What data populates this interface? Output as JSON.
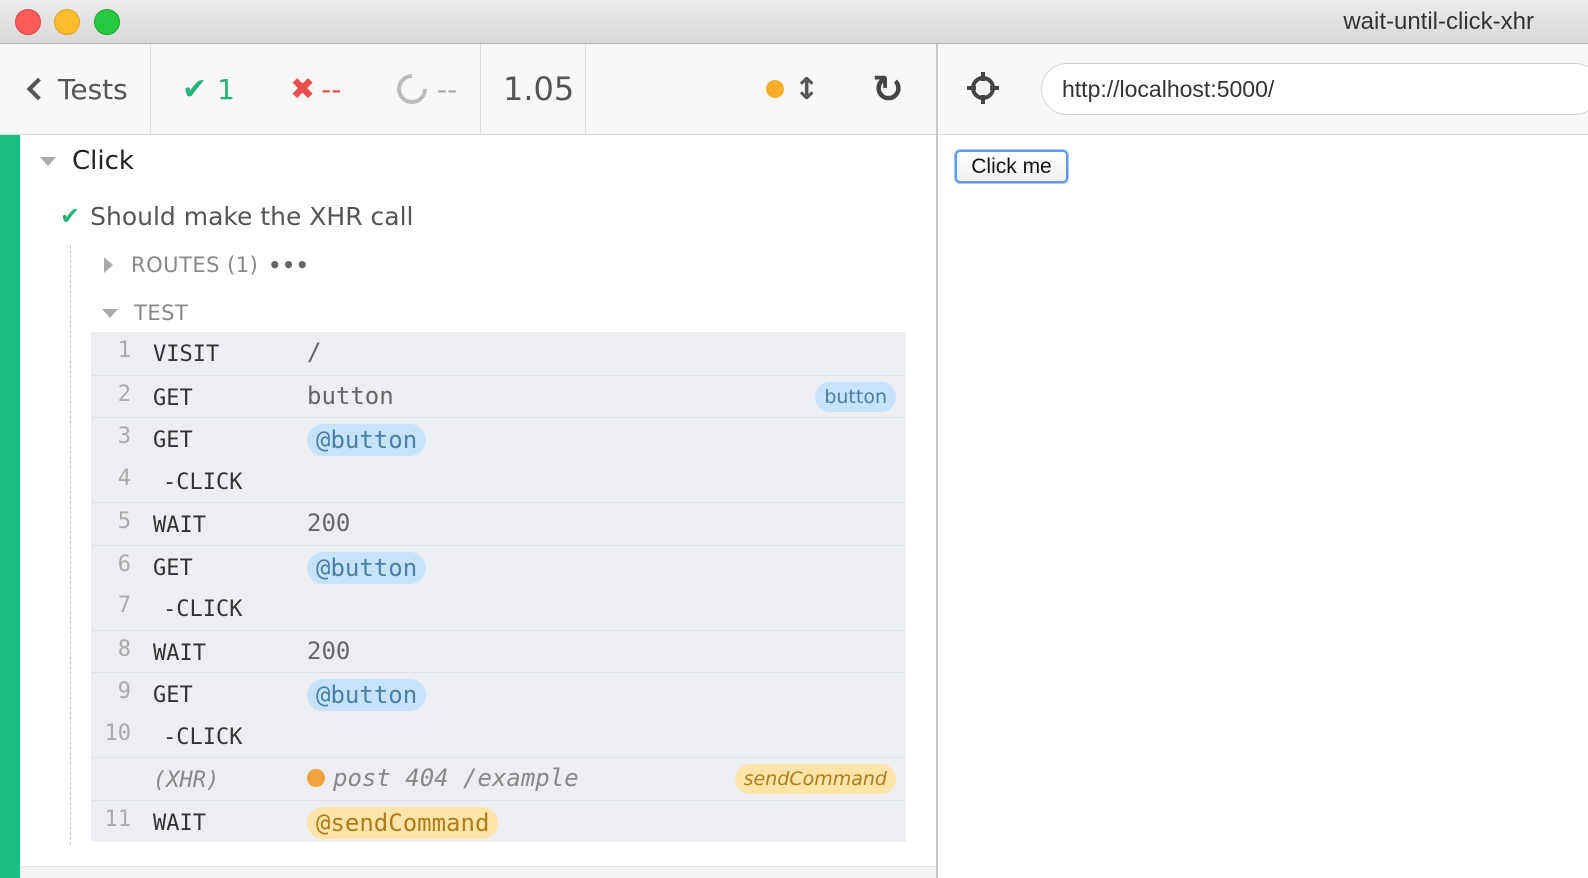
{
  "window": {
    "title": "wait-until-click-xhr"
  },
  "header": {
    "tests_label": "Tests",
    "passed": "1",
    "failed": "--",
    "pending": "--",
    "duration": "1.05"
  },
  "aut": {
    "url": "http://localhost:5000/",
    "button_label": "Click me"
  },
  "runnables": {
    "suite_title": "Click",
    "test_title": "Should make the XHR call",
    "routes_label": "ROUTES (1)",
    "test_label": "TEST",
    "routes_more": "•••"
  },
  "commands": [
    {
      "num": "1",
      "name": "VISIT",
      "msg": "/",
      "pill": false,
      "badge": ""
    },
    {
      "num": "2",
      "name": "GET",
      "msg": "button",
      "pill": false,
      "badge": "button"
    },
    {
      "num": "3",
      "name": "GET",
      "msg": "@button",
      "pill": true,
      "badge": ""
    },
    {
      "num": "4",
      "name": "-CLICK",
      "msg": "",
      "pill": false,
      "badge": "",
      "child": true
    },
    {
      "num": "5",
      "name": "WAIT",
      "msg": "200",
      "pill": false,
      "badge": ""
    },
    {
      "num": "6",
      "name": "GET",
      "msg": "@button",
      "pill": true,
      "badge": ""
    },
    {
      "num": "7",
      "name": "-CLICK",
      "msg": "",
      "pill": false,
      "badge": "",
      "child": true
    },
    {
      "num": "8",
      "name": "WAIT",
      "msg": "200",
      "pill": false,
      "badge": ""
    },
    {
      "num": "9",
      "name": "GET",
      "msg": "@button",
      "pill": true,
      "badge": ""
    },
    {
      "num": "10",
      "name": "-CLICK",
      "msg": "",
      "pill": false,
      "badge": "",
      "child": true
    },
    {
      "num": "",
      "name": "(XHR)",
      "msg": "post 404 /example",
      "xhr": true,
      "badge": "sendCommand"
    },
    {
      "num": "11",
      "name": "WAIT",
      "msg": "@sendCommand",
      "pill": true,
      "orange": true,
      "badge": ""
    }
  ],
  "colors": {
    "passed": "#25b37a",
    "failed": "#e94f4f",
    "accent": "#1cbd82",
    "alias_blue": "#c7e3fb",
    "alias_orange": "#fde4a8"
  }
}
